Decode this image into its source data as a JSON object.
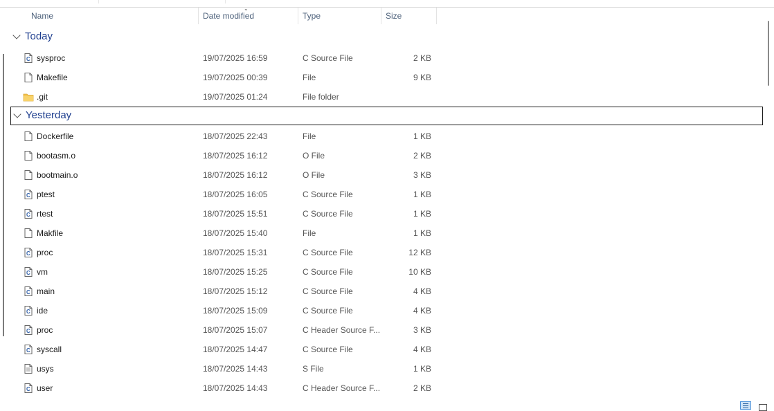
{
  "columns": {
    "name": "Name",
    "date": "Date modified",
    "type": "Type",
    "size": "Size"
  },
  "groups": [
    {
      "label": "Today",
      "rows": [
        {
          "name": "sysproc",
          "date": "19/07/2025 16:59",
          "type": "C Source File",
          "size": "2 KB",
          "icon": "c-file-icon"
        },
        {
          "name": "Makefile",
          "date": "19/07/2025 00:39",
          "type": "File",
          "size": "9 KB",
          "icon": "file-icon"
        },
        {
          "name": ".git",
          "date": "19/07/2025 01:24",
          "type": "File folder",
          "size": "",
          "icon": "folder-icon"
        }
      ]
    },
    {
      "label": "Yesterday",
      "rows": [
        {
          "name": "Dockerfile",
          "date": "18/07/2025 22:43",
          "type": "File",
          "size": "1 KB",
          "icon": "file-icon"
        },
        {
          "name": "bootasm.o",
          "date": "18/07/2025 16:12",
          "type": "O File",
          "size": "2 KB",
          "icon": "file-icon"
        },
        {
          "name": "bootmain.o",
          "date": "18/07/2025 16:12",
          "type": "O File",
          "size": "3 KB",
          "icon": "file-icon"
        },
        {
          "name": "ptest",
          "date": "18/07/2025 16:05",
          "type": "C Source File",
          "size": "1 KB",
          "icon": "c-file-icon"
        },
        {
          "name": "rtest",
          "date": "18/07/2025 15:51",
          "type": "C Source File",
          "size": "1 KB",
          "icon": "c-file-icon"
        },
        {
          "name": "Makfile",
          "date": "18/07/2025 15:40",
          "type": "File",
          "size": "1 KB",
          "icon": "file-icon"
        },
        {
          "name": "proc",
          "date": "18/07/2025 15:31",
          "type": "C Source File",
          "size": "12 KB",
          "icon": "c-file-icon"
        },
        {
          "name": "vm",
          "date": "18/07/2025 15:25",
          "type": "C Source File",
          "size": "10 KB",
          "icon": "c-file-icon"
        },
        {
          "name": "main",
          "date": "18/07/2025 15:12",
          "type": "C Source File",
          "size": "4 KB",
          "icon": "c-file-icon"
        },
        {
          "name": "ide",
          "date": "18/07/2025 15:09",
          "type": "C Source File",
          "size": "4 KB",
          "icon": "c-file-icon"
        },
        {
          "name": "proc",
          "date": "18/07/2025 15:07",
          "type": "C Header Source F...",
          "size": "3 KB",
          "icon": "c-file-icon"
        },
        {
          "name": "syscall",
          "date": "18/07/2025 14:47",
          "type": "C Source File",
          "size": "4 KB",
          "icon": "c-file-icon"
        },
        {
          "name": "usys",
          "date": "18/07/2025 14:43",
          "type": "S File",
          "size": "1 KB",
          "icon": "text-file-icon"
        },
        {
          "name": "user",
          "date": "18/07/2025 14:43",
          "type": "C Header Source F...",
          "size": "2 KB",
          "icon": "c-file-icon"
        }
      ]
    }
  ],
  "colors": {
    "group_label": "#1f3f8f",
    "header_text": "#4c607a",
    "folder": "#f3c24c"
  }
}
